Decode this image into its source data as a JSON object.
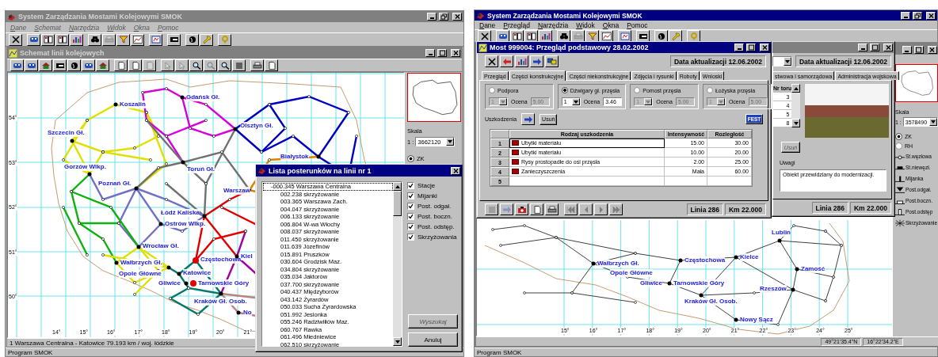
{
  "left": {
    "window": {
      "title": "System Zarządzania Mostami Kolejowymi SMOK",
      "active": false
    },
    "menu": [
      {
        "label": "Dane",
        "disabled": true
      },
      {
        "label": "Schemat",
        "disabled": true
      },
      {
        "label": "Narzędzia",
        "disabled": true
      },
      {
        "label": "Widok",
        "disabled": true
      },
      {
        "label": "Okna",
        "disabled": true
      },
      {
        "label": "Pomoc",
        "disabled": true
      }
    ],
    "map_window": {
      "title": "Schemat linii kolejowych",
      "active": false,
      "cities": [
        {
          "name": "Gdańsk Gł.",
          "highlighted": false
        },
        {
          "name": "Koszalin",
          "highlighted": false
        },
        {
          "name": "Olsztyn Gł.",
          "highlighted": false
        },
        {
          "name": "Szczecin Gł.",
          "highlighted": false
        },
        {
          "name": "Białystok",
          "highlighted": false
        },
        {
          "name": "Gorzów Wlkp.",
          "highlighted": false
        },
        {
          "name": "Toruń Gł.",
          "highlighted": false
        },
        {
          "name": "Warszaw",
          "highlighted": false
        },
        {
          "name": "Poznań Gł.",
          "highlighted": false
        },
        {
          "name": "Łódź Kaliska",
          "highlighted": false
        },
        {
          "name": "Ostrów Wlkp.",
          "highlighted": false
        },
        {
          "name": "Wrocław Gł.",
          "highlighted": false
        },
        {
          "name": "Częstochowa",
          "highlighted": true
        },
        {
          "name": "Kiel",
          "highlighted": false
        },
        {
          "name": "Wałbrzych Gł.",
          "highlighted": false
        },
        {
          "name": "Opole Główne",
          "highlighted": false
        },
        {
          "name": "Katowice",
          "highlighted": false
        },
        {
          "name": "Gliwice",
          "highlighted": false
        },
        {
          "name": "Tarnowskie Góry",
          "highlighted": true
        },
        {
          "name": "Kraków Gł. Osob.",
          "highlighted": false
        },
        {
          "name": "No",
          "highlighted": false
        }
      ],
      "lon_ticks": [
        "14°",
        "15°",
        "16°",
        "17°",
        "18°",
        "19°",
        "20°",
        "21°"
      ],
      "lat_ticks": [
        "54°",
        "53°",
        "52°",
        "51°",
        "50°"
      ],
      "scale": {
        "label": "Skala",
        "prefix": "1 :",
        "value": "3662120"
      },
      "layers": [
        {
          "label": "ZK",
          "selected": true
        }
      ],
      "status": "1 Warszawa Centralna - Katowice 79.193 km / woj. łódzkie"
    },
    "dialog": {
      "title": "Lista posterunków na linii nr 1",
      "items": [
        {
          "label": "-000.345  Warszawa Centralna",
          "selected": true
        },
        {
          "label": "002.238  skrzyżowanie",
          "selected": false
        },
        {
          "label": "003.365  Warszawa Zach.",
          "selected": false
        },
        {
          "label": "004.047  skrzyżowanie",
          "selected": false
        },
        {
          "label": "006.133  skrzyżowanie",
          "selected": false
        },
        {
          "label": "006.804  W-wa Włochy",
          "selected": false
        },
        {
          "label": "008.037  skrzyżowanie",
          "selected": false
        },
        {
          "label": "011.450  skrzyżowanie",
          "selected": false
        },
        {
          "label": "011.639  Józefinów",
          "selected": false
        },
        {
          "label": "015.891  Pruszków",
          "selected": false
        },
        {
          "label": "030.604  Grodzisk Maz.",
          "selected": false
        },
        {
          "label": "034.804  skrzyżowanie",
          "selected": false
        },
        {
          "label": "035.034  Jaktorów",
          "selected": false
        },
        {
          "label": "037.700  skrzyżowanie",
          "selected": false
        },
        {
          "label": "040.437  Międzyborów",
          "selected": false
        },
        {
          "label": "043.142  Żyrardów",
          "selected": false
        },
        {
          "label": "050.033  Sucha Żyrardowska",
          "selected": false
        },
        {
          "label": "051.992  Jesionka",
          "selected": false
        },
        {
          "label": "055.246  Radziwiłłów Maz.",
          "selected": false
        },
        {
          "label": "060.767  Rawka",
          "selected": false
        },
        {
          "label": "061.496  Miedniewice",
          "selected": false
        },
        {
          "label": "062.510  skrzyżowanie",
          "selected": false
        }
      ],
      "filters": [
        {
          "label": "Stacje",
          "checked": true
        },
        {
          "label": "Mijanki",
          "checked": true
        },
        {
          "label": "Post. odgał.",
          "checked": true
        },
        {
          "label": "Post. boczn.",
          "checked": true
        },
        {
          "label": "Post. odstęp.",
          "checked": true
        },
        {
          "label": "Skrzyżowania",
          "checked": true
        }
      ],
      "buttons": [
        {
          "label": "Wyszukaj",
          "disabled": true
        },
        {
          "label": "Anuluj",
          "disabled": false
        }
      ]
    },
    "status_bar": "Program SMOK"
  },
  "right": {
    "window": {
      "title": "System Zarządzania Mostami Kolejowymi SMOK",
      "active": true
    },
    "menu": [
      {
        "label": "Dane",
        "disabled": false
      },
      {
        "label": "Przegląd",
        "disabled": false
      },
      {
        "label": "Narzędzia",
        "disabled": false
      },
      {
        "label": "Widok",
        "disabled": false
      },
      {
        "label": "Okna",
        "disabled": false
      },
      {
        "label": "Pomoc",
        "disabled": false
      }
    ],
    "inspection": {
      "title": "Most 999004: Przegląd podstawowy 28.02.2002",
      "active": true,
      "updated": "Data aktualizacji 12.06.2002",
      "tabs": [
        {
          "label": "Przegląd",
          "selected": false
        },
        {
          "label": "Części konstrukcyjne",
          "selected": true
        },
        {
          "label": "Części niekonstrukcyjne",
          "selected": false
        },
        {
          "label": "Zdjęcia i rysunki",
          "selected": false
        },
        {
          "label": "Roboty",
          "selected": false
        },
        {
          "label": "Wnioski",
          "selected": false
        }
      ],
      "groups": [
        {
          "label": "Podpora",
          "selected": false,
          "span": "1",
          "grade_label": "Ocena",
          "grade": "5.00"
        },
        {
          "label": "Dźwigary gł. przęsła",
          "selected": true,
          "span": "1",
          "grade_label": "Ocena",
          "grade": "3.46"
        },
        {
          "label": "Pomost przęsła",
          "selected": false,
          "span": "1",
          "grade_label": "Ocena",
          "grade": "5.00"
        },
        {
          "label": "Łożyska przęsła",
          "selected": false,
          "span": "1",
          "grade_label": "Ocena",
          "grade": "5.00"
        }
      ],
      "damage_label": "Uszkodzenia",
      "remove_button": "Usuń",
      "fest_button": "FEST",
      "columns": [
        "Rodzaj uszkodzenia",
        "Intensywność",
        "Rozległość"
      ],
      "rows": [
        {
          "num": "1",
          "type": "Ubytki materiału",
          "intensity": "15.00",
          "extent": "30.00",
          "selected": true
        },
        {
          "num": "2",
          "type": "Ubytki materiału",
          "intensity": "10.00",
          "extent": "20.00",
          "selected": false
        },
        {
          "num": "3",
          "type": "Rysy prostopadłe do osi przęsła",
          "intensity": "2.00",
          "extent": "25.00",
          "selected": false
        },
        {
          "num": "4",
          "type": "Zanieczyszczenia",
          "intensity": "Mała",
          "extent": "60.00",
          "selected": false
        },
        {
          "num": "5",
          "selected": false
        }
      ],
      "line": "Linia 286",
      "km": "Km 22.000"
    },
    "bridge": {
      "active": false,
      "updated": "Data aktualizacji 12.06.2002",
      "tabs": [
        {
          "label": "stwowa i samorządowa",
          "selected": false
        },
        {
          "label": "Administracja wojskowa",
          "selected": false
        }
      ],
      "track_header": "Nr toru",
      "tracks": [
        "3",
        "4",
        "5",
        "8"
      ],
      "remove_button": "Usuń",
      "notes_label": "Uwagi",
      "notes": "Obiekt przewidziany do modernizacji.",
      "line": "Linia 286",
      "km": "Km 22.000"
    },
    "map_window": {
      "active": false,
      "cities": [
        {
          "name": "Wałbrzych Gł.",
          "highlighted": false
        },
        {
          "name": "Opole Główne",
          "highlighted": false
        },
        {
          "name": "Częstochowa",
          "highlighted": false
        },
        {
          "name": "Kielce",
          "highlighted": false
        },
        {
          "name": "Gliwice",
          "highlighted": false
        },
        {
          "name": "Tarnowskie Góry",
          "highlighted": false
        },
        {
          "name": "Kraków Gł. Osob.",
          "highlighted": false
        },
        {
          "name": "Rzeszów",
          "highlighted": false
        },
        {
          "name": "Nowy Sącz",
          "highlighted": false
        },
        {
          "name": "Lublin",
          "highlighted": false
        },
        {
          "name": "Zamość",
          "highlighted": false
        }
      ],
      "lon_ticks": [
        "15°",
        "16°",
        "17°",
        "18°",
        "19°",
        "20°",
        "21°",
        "22°",
        "23°",
        "24°",
        "25°"
      ],
      "scale": {
        "label": "Skala",
        "prefix": "1 :",
        "value": "3578490"
      },
      "layers": [
        {
          "label": "ZK",
          "selected": true
        },
        {
          "label": "RH",
          "selected": false
        }
      ],
      "legend": [
        {
          "kind": "junction",
          "label": "St.węzłowa"
        },
        {
          "kind": "station",
          "label": "St.niewęzł."
        },
        {
          "kind": "passing",
          "label": "Mijanka"
        },
        {
          "kind": "branch",
          "label": "Post.odgał."
        },
        {
          "kind": "siding",
          "label": "Post.boczn."
        },
        {
          "kind": "block",
          "label": "Post.odstęp"
        },
        {
          "kind": "crossing",
          "label": "Skrzyżowanie"
        }
      ],
      "coordinates": [
        "49°21'35.4\"N",
        "16°22'34.2\"E"
      ]
    },
    "status_bar": "Program SMOK"
  }
}
